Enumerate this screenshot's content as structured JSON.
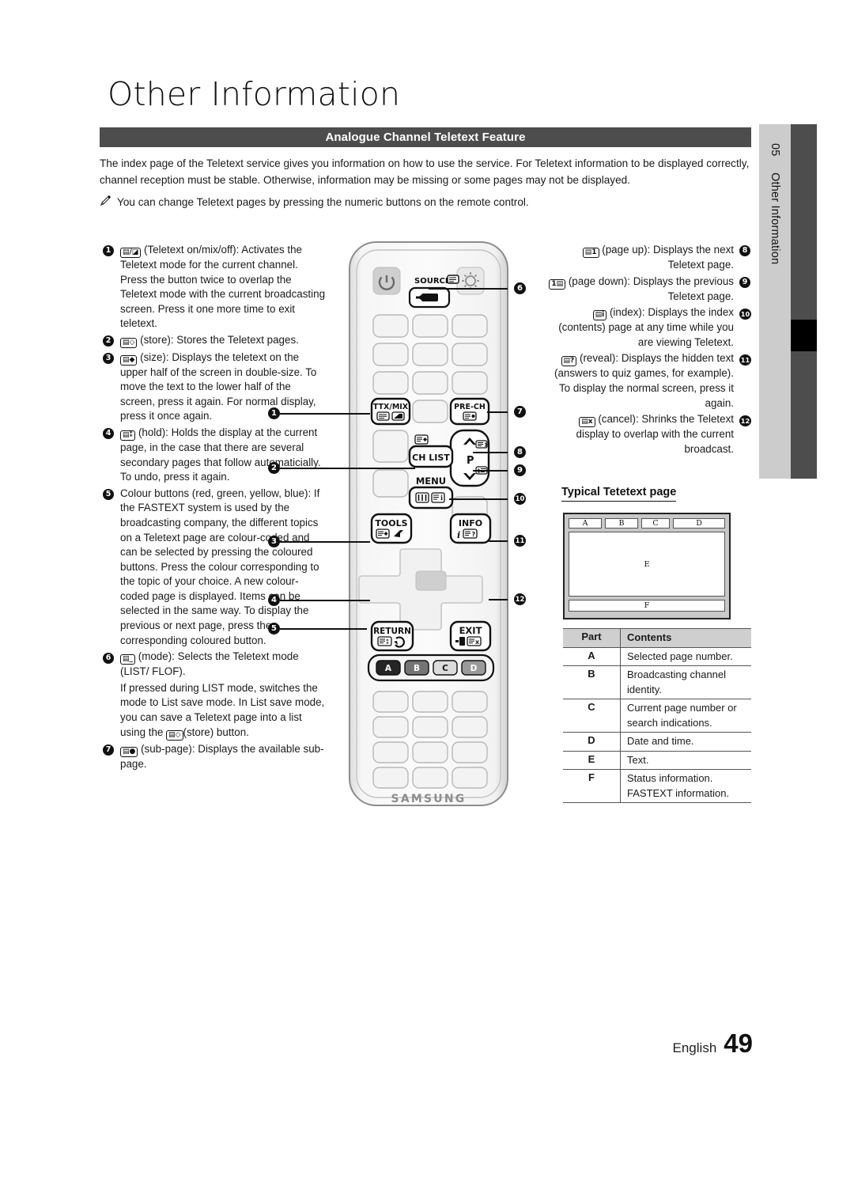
{
  "page": {
    "title": "Other Information",
    "section_header": "Analogue Channel Teletext Feature",
    "intro": "The index page of the Teletext service gives you information on how to use the service. For Teletext information to be displayed correctly, channel reception must be stable. Otherwise, information may be missing or some pages may not be displayed.",
    "note": "You can change Teletext pages by pressing the numeric buttons on the remote control.",
    "note_icon": "pencil-icon"
  },
  "sidebar": {
    "chapter_number": "05",
    "chapter_title": "Other Information",
    "band_light_color": "#cccccc",
    "band_dark_color": "#4d4d4d",
    "marker_color": "#000000"
  },
  "left_items": [
    {
      "num": "1",
      "key": "on/mix",
      "text": " (Teletext on/mix/off): Activates the Teletext mode for the current channel. Press the button twice to overlap the Teletext mode with the current broadcasting screen. Press it one more time to exit teletext."
    },
    {
      "num": "2",
      "key": "store",
      "text": " (store): Stores the Teletext pages."
    },
    {
      "num": "3",
      "key": "size",
      "text": " (size): Displays the teletext on the upper half of the screen in double-size. To move the text to the lower half of the screen, press it again. For normal display, press it once again."
    },
    {
      "num": "4",
      "key": "hold",
      "text": " (hold): Holds the display at the current page, in the case that there are several secondary pages that follow automaticially. To undo, press it again."
    },
    {
      "num": "5",
      "key": "",
      "text": "Colour buttons (red, green, yellow, blue): If the FASTEXT system is used by the broadcasting company, the different topics on a Teletext page are colour-coded and can be selected by pressing the coloured buttons. Press the colour corresponding to the topic of your choice. A new colour-coded page is displayed. Items can be selected in the same way. To display the previous or next page, press the corresponding coloured button."
    },
    {
      "num": "6",
      "key": "mode",
      "text": " (mode): Selects the Teletext mode (LIST/ FLOF)."
    },
    {
      "num": "",
      "key": "",
      "text_pre": "If pressed during LIST mode, switches the mode to List save mode. In List save mode, you can save a Teletext page into a list using the ",
      "key_inline": "store",
      "text_post": "(store) button."
    },
    {
      "num": "7",
      "key": "sub-page",
      "text": " (sub-page): Displays the available sub-page."
    }
  ],
  "right_items": [
    {
      "num": "8",
      "key": "page-up",
      "text": " (page up): Displays the next Teletext page."
    },
    {
      "num": "9",
      "key": "page-down",
      "text": " (page down): Displays the previous Teletext page."
    },
    {
      "num": "10",
      "key": "index",
      "text": " (index): Displays the index (contents) page at any time while you are viewing Teletext."
    },
    {
      "num": "11",
      "key": "reveal",
      "text": " (reveal): Displays the hidden text (answers to quiz games, for example). To display the normal screen, press it again."
    },
    {
      "num": "12",
      "key": "cancel",
      "text": " (cancel): Shrinks the Teletext display to overlap with the current broadcast."
    }
  ],
  "teletext_page": {
    "heading": "Typical Tetetext page",
    "regions": [
      "A",
      "B",
      "C",
      "D",
      "E",
      "F"
    ]
  },
  "parts_table": {
    "headers": [
      "Part",
      "Contents"
    ],
    "rows": [
      {
        "part": "A",
        "contents": "Selected page number."
      },
      {
        "part": "B",
        "contents": "Broadcasting channel identity."
      },
      {
        "part": "C",
        "contents": "Current page number or search indications."
      },
      {
        "part": "D",
        "contents": "Date and time."
      },
      {
        "part": "E",
        "contents": "Text."
      },
      {
        "part": "F",
        "contents": "Status information. FASTEXT information."
      }
    ]
  },
  "remote": {
    "brand": "SAMSUNG",
    "labels": {
      "source": "SOURCE",
      "ttxmix": "TTX/MIX",
      "prech": "PRE-CH",
      "chlist": "CH LIST",
      "menu": "MENU",
      "tools": "TOOLS",
      "info": "INFO",
      "return": "RETURN",
      "exit": "EXIT",
      "p": "P"
    },
    "colour_buttons": [
      "A",
      "B",
      "C",
      "D"
    ],
    "callouts": [
      "1",
      "2",
      "3",
      "4",
      "5",
      "6",
      "7",
      "8",
      "9",
      "10",
      "11",
      "12"
    ]
  },
  "footer": {
    "language": "English",
    "page_number": "49"
  }
}
